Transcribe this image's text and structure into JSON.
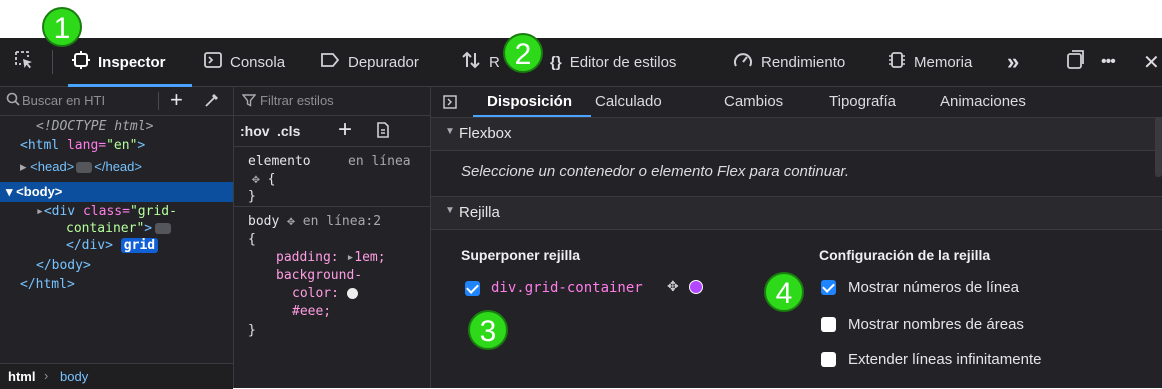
{
  "annotations": [
    "1",
    "2",
    "3",
    "4"
  ],
  "toolbar": {
    "tabs": [
      "Inspector",
      "Consola",
      "Depurador",
      "R",
      "Editor de estilos",
      "Rendimiento",
      "Memoria"
    ],
    "more": "»",
    "overflow": "•••",
    "close": "✕"
  },
  "markup": {
    "search_placeholder": "Buscar en HTI",
    "doctype": "<!DOCTYPE html>",
    "html_open_tag": "<html",
    "html_attr": "lang=",
    "html_attr_val": "\"en\"",
    "html_close_bracket": ">",
    "head": "<head>",
    "head_close": "</head>",
    "body_open": "<body>",
    "div_open": "<div",
    "div_attr": "class=",
    "div_attr_val": "\"grid-",
    "div_attr_val2": "container\"",
    "div_close": "</div>",
    "grid_badge": "grid",
    "body_close": "</body>",
    "html_close": "</html>",
    "breadcrumb": [
      "html",
      "body"
    ]
  },
  "rules": {
    "filter_placeholder": "Filtrar estilos",
    "hov": ":hov",
    "cls": ".cls",
    "rule1_selector": "elemento",
    "rule1_source": "en línea",
    "rule1_brace": "{",
    "rule_close": "}",
    "rule2_selector": "body",
    "rule2_source": "en línea:2",
    "rule2_brace": "{",
    "decl1_prop": "padding:",
    "decl1_val": "1em;",
    "decl2_prop": "background-",
    "decl2_prop2": "color:",
    "decl2_val": "#eee;"
  },
  "layout_panel": {
    "tabs": [
      "Disposición",
      "Calculado",
      "Cambios",
      "Tipografía",
      "Animaciones"
    ],
    "flexbox_title": "Flexbox",
    "flexbox_msg": "Seleccione un contenedor o elemento Flex para continuar.",
    "grid_title": "Rejilla",
    "overlay_title": "Superponer rejilla",
    "overlay_item": "div.grid-container",
    "overlay_color": "#b347ff",
    "settings_title": "Configuración de la rejilla",
    "settings": [
      {
        "label": "Mostrar números de línea",
        "checked": true
      },
      {
        "label": "Mostrar nombres de áreas",
        "checked": false
      },
      {
        "label": "Extender líneas infinitamente",
        "checked": false
      }
    ]
  },
  "colors": {
    "accent": "#4aa3ff",
    "badge": "#2ed91a",
    "selection": "#0c4f9e"
  }
}
